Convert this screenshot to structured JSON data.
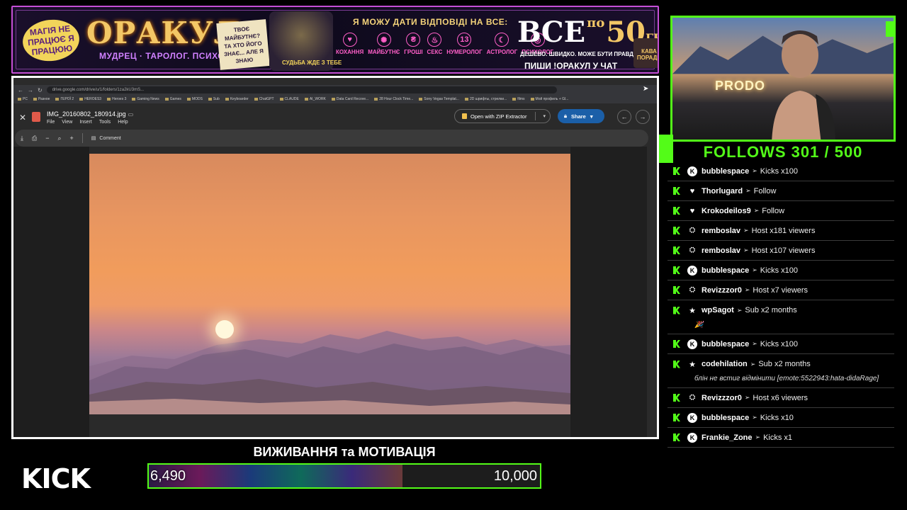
{
  "banner": {
    "magic": "МАГІЯ НЕ ПРАЦЮЄ Я ПРАЦЮЮ",
    "title": "ОРАКУЛ",
    "subtitle": "МУДРЕЦ · ТАРОЛОГ. ПСИХОЛОГ.",
    "card_text": "ТВОЄ МАЙБУТНЄ? ТА ХТО ЙОГО ЗНАЄ... АЛЕ Я ЗНАЮ",
    "wizard_caption": "СУДЬБА ЖДЕ З ТЕБЕ",
    "answer_line": "Я МОЖУ ДАТИ ВІДПОВІДІ НА ВСЕ:",
    "categories": [
      {
        "label": "КОХАННЯ",
        "icon": "♥"
      },
      {
        "label": "МАЙБУТНЄ",
        "icon": "✺"
      },
      {
        "label": "ГРОШІ",
        "icon": "₴"
      },
      {
        "label": "СЕКС",
        "icon": "♨"
      },
      {
        "label": "НУМЕРОЛОГ",
        "icon": "13"
      },
      {
        "label": "АСТРОЛОГ",
        "icon": "☾"
      },
      {
        "label": "ПСИХОЛОГ",
        "icon": "◎"
      }
    ],
    "price_all": "ВСЕ",
    "price_po": "по",
    "price_value": "50",
    "price_unit": "ГРН.",
    "tagline": "ДЕШЕВО. ШВИДКО. МОЖЕ БУТИ ПРАВДА.",
    "cta": "ПИШИ !ОРАКУЛ У ЧАТ",
    "mug": "КАВА ПОРАДИ"
  },
  "browser": {
    "url": "drive.google.com/drive/u/1/folders/1za2kU3mS...",
    "bookmarks": [
      "PC",
      "Разное",
      "ГЕРОЇ 2",
      "HEROES3",
      "Heroes 3",
      "Gaming News",
      "Games",
      "MODS",
      "Sub",
      "Keyboarder",
      "ChatGPT",
      "CLAUDE",
      "AI_WORK",
      "Data Card Recove...",
      "28 Hour Clock Time...",
      "Sony Vegas Templat...",
      "2D шрифты, стрелки...",
      "films",
      "Мой профиль + Gl..."
    ]
  },
  "viewer": {
    "file_name": "IMG_20160802_180914.jpg",
    "menu": [
      "File",
      "View",
      "Insert",
      "Tools",
      "Help"
    ],
    "zip_button": "Open with ZIP Extractor",
    "share_button": "Share",
    "comment_label": "Comment",
    "prev_icon": "←",
    "next_icon": "→"
  },
  "goal": {
    "title": "ВИЖИВАННЯ та МОТИВАЦІЯ",
    "current": "6,490",
    "target": "10,000",
    "progress": 0.649
  },
  "kick_logo": "KICK",
  "cam": {
    "sign": "PRODO"
  },
  "follows": "FOLLOWS 301 / 500",
  "events": [
    {
      "icon": "kicks",
      "user": "bubblespace",
      "action": "Kicks x100"
    },
    {
      "icon": "heart",
      "user": "Thorlugard",
      "action": "Follow"
    },
    {
      "icon": "heart",
      "user": "Krokodeilos9",
      "action": "Follow"
    },
    {
      "icon": "host",
      "user": "remboslav",
      "action": "Host x181 viewers"
    },
    {
      "icon": "host",
      "user": "remboslav",
      "action": "Host x107 viewers"
    },
    {
      "icon": "kicks",
      "user": "bubblespace",
      "action": "Kicks x100"
    },
    {
      "icon": "host",
      "user": "Revizzzor0",
      "action": "Host x7 viewers"
    },
    {
      "icon": "star",
      "user": "wpSagot",
      "action": "Sub x2 months",
      "message": "🎉"
    },
    {
      "icon": "kicks",
      "user": "bubblespace",
      "action": "Kicks x100"
    },
    {
      "icon": "star",
      "user": "codehilation",
      "action": "Sub x2 months",
      "message": "блін не встиг відмінити [emote:5522943:hata-didaRage]"
    },
    {
      "icon": "host",
      "user": "Revizzzor0",
      "action": "Host x6 viewers"
    },
    {
      "icon": "kicks",
      "user": "bubblespace",
      "action": "Kicks x10"
    },
    {
      "icon": "kicks",
      "user": "Frankie_Zone",
      "action": "Kicks x1"
    }
  ],
  "colors": {
    "kick_green": "#53fc18",
    "banner_border": "#c54fd6",
    "share_blue": "#1b5fa8"
  }
}
